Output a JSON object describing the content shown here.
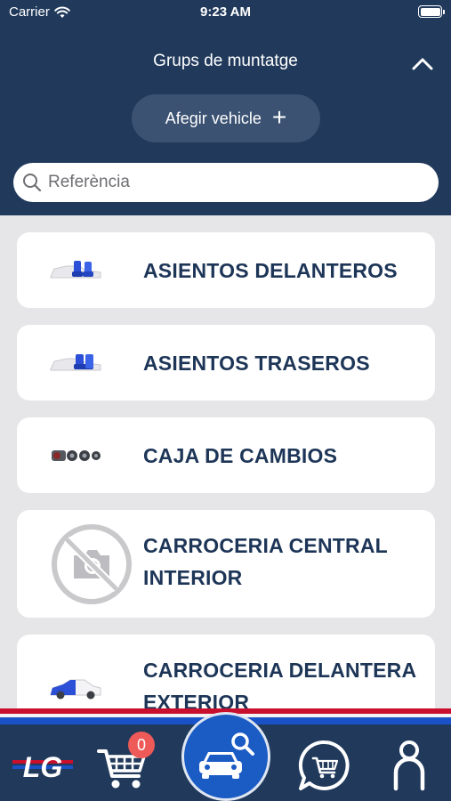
{
  "status_bar": {
    "carrier": "Carrier",
    "time": "9:23 AM"
  },
  "header": {
    "title": "Grups de muntatge",
    "add_vehicle_label": "Afegir vehicle"
  },
  "search": {
    "placeholder": "Referència",
    "value": ""
  },
  "groups": [
    {
      "label": "ASIENTOS DELANTEROS",
      "icon": "front-seats-icon"
    },
    {
      "label": "ASIENTOS TRASEROS",
      "icon": "rear-seats-icon"
    },
    {
      "label": "CAJA DE CAMBIOS",
      "icon": "gearbox-icon"
    },
    {
      "label": "CARROCERIA CENTRAL INTERIOR",
      "icon": "no-photo-icon"
    },
    {
      "label": "CARROCERIA DELANTERA EXTERIOR",
      "icon": "front-body-icon"
    }
  ],
  "tabbar": {
    "logo": "LG",
    "cart_count": "0",
    "colors": {
      "navy": "#213a5c",
      "blue": "#1852c6",
      "red": "#c8102e",
      "badge": "#ee5a57"
    }
  }
}
